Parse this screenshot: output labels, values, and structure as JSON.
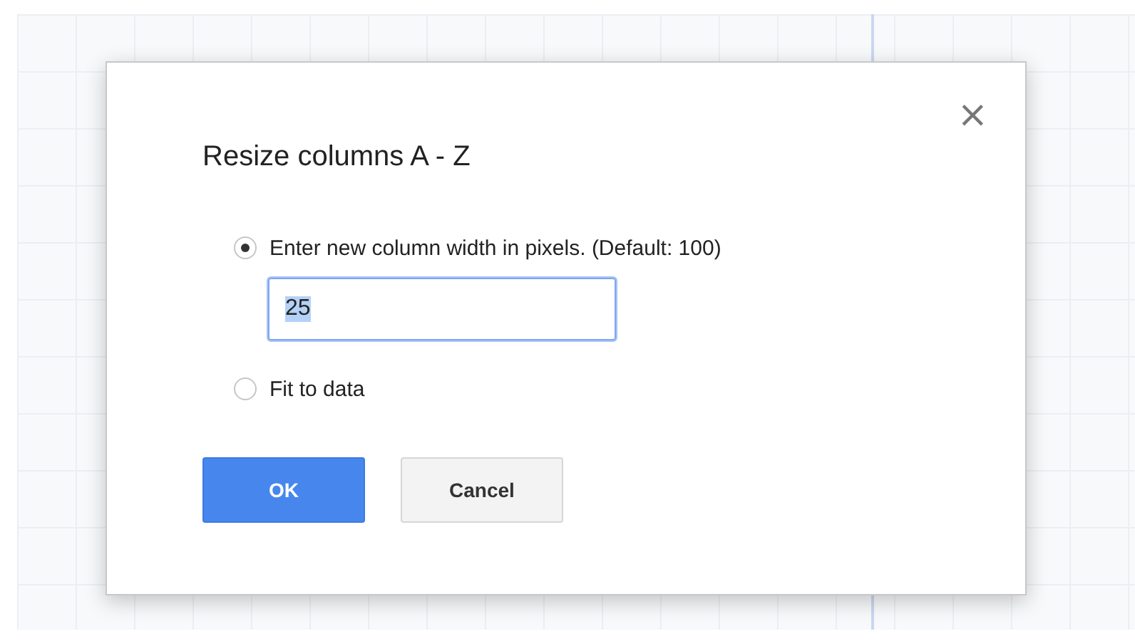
{
  "dialog": {
    "title": "Resize columns A - Z",
    "close": "×",
    "options": [
      {
        "label": "Enter new column width in pixels. (Default: 100)",
        "selected": true
      },
      {
        "label": "Fit to data",
        "selected": false
      }
    ],
    "width_field": {
      "value": "25",
      "value_highlighted": true
    },
    "buttons": [
      {
        "label": "OK",
        "kind": "primary"
      },
      {
        "label": "Cancel",
        "kind": "secondary"
      }
    ]
  }
}
